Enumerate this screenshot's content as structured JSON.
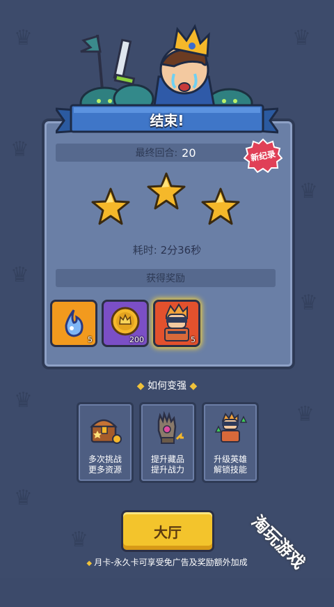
{
  "header": {
    "title": "结束!"
  },
  "final_round": {
    "label": "最终回合:",
    "value": "20"
  },
  "record_badge": "新纪录",
  "stars": {
    "earned": 3,
    "total": 3
  },
  "time": {
    "label": "耗时:",
    "value": "2分36秒"
  },
  "rewards": {
    "title": "获得奖励",
    "items": [
      {
        "name": "blue-flame-soul-icon",
        "count": "5",
        "bg": "#f29a1e"
      },
      {
        "name": "gold-crown-coin-icon",
        "count": "200",
        "bg": "#7b4fc6"
      },
      {
        "name": "hero-card-icon",
        "count": "5",
        "bg": "#e3512d"
      }
    ]
  },
  "how_to_strengthen": {
    "title": "如何变强",
    "tips": [
      {
        "line1": "多次挑战",
        "line2": "更多资源",
        "icon": "treasure-chest-icon"
      },
      {
        "line1": "提升藏品",
        "line2": "提升战力",
        "icon": "gauntlet-icon"
      },
      {
        "line1": "升级英雄",
        "line2": "解锁技能",
        "icon": "hero-upgrade-icon"
      }
    ]
  },
  "lobby_button": "大厅",
  "footer_text": "月卡-永久卡可享受免广告及奖励额外加成",
  "watermark": "淘玩游戏",
  "colors": {
    "panel": "#6a7fa6",
    "banner": "#3f76c8",
    "button": "#f3c42c",
    "star": "#f5b82a"
  }
}
